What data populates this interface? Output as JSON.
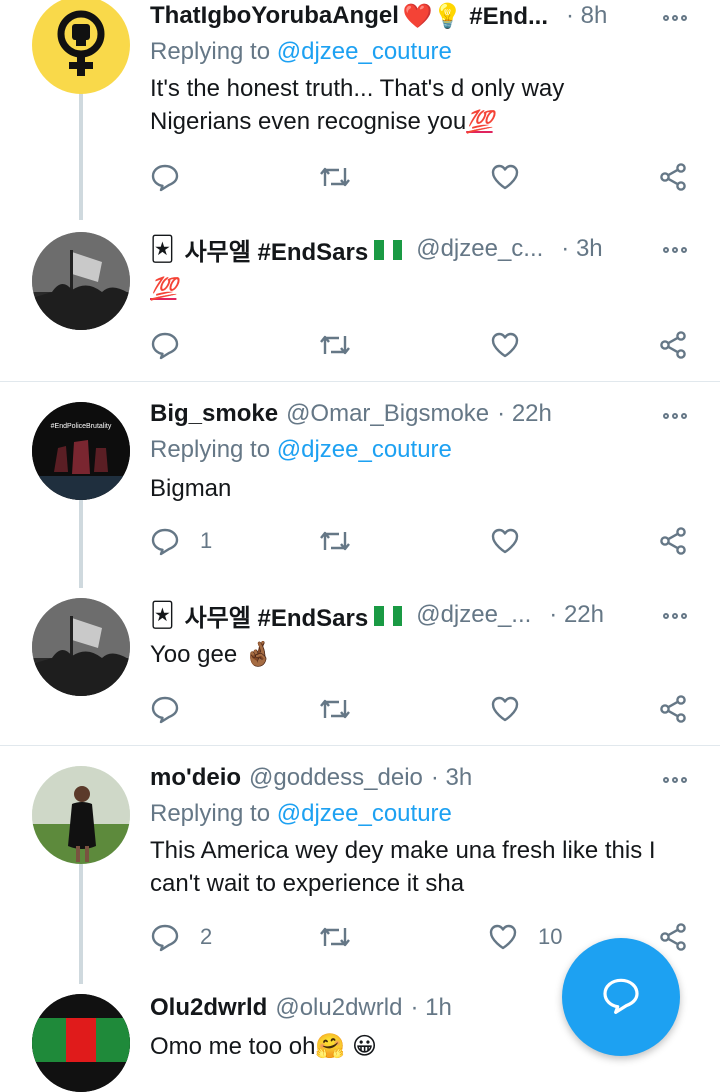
{
  "tweets": [
    {
      "name": "ThatIgboYorubaAngel",
      "name_suffix": "❤️💡 #End...",
      "handle": "",
      "time": "· 8h",
      "reply_prefix": "Replying to",
      "reply_to": "@djzee_couture",
      "text_lines": [
        "It's the honest truth... That's d only way",
        "Nigerians even recognise you"
      ],
      "text_emoji": "💯",
      "reply_count": "",
      "like_count": ""
    },
    {
      "name_prefix": "🃏",
      "name": "사무엘 #EndSars",
      "handle": "@djzee_c...",
      "time": "· 3h",
      "text": "💯",
      "reply_count": "",
      "like_count": ""
    },
    {
      "name": "Big_smoke",
      "handle": "@Omar_Bigsmoke",
      "time": "· 22h",
      "reply_prefix": "Replying to",
      "reply_to": "@djzee_couture",
      "text": "Bigman",
      "reply_count": "1",
      "like_count": ""
    },
    {
      "name_prefix": "🃏",
      "name": "사무엘 #EndSars",
      "handle": "@djzee_...",
      "time": "· 22h",
      "text": "Yoo gee 🤞🏾",
      "reply_count": "",
      "like_count": ""
    },
    {
      "name": "mo'deio",
      "handle": "@goddess_deio",
      "time": "· 3h",
      "reply_prefix": "Replying to",
      "reply_to": "@djzee_couture",
      "text_lines": [
        "This America wey dey make una fresh like this I",
        "can't wait to experience it sha"
      ],
      "reply_count": "2",
      "like_count": "10"
    },
    {
      "name": "Olu2dwrld",
      "handle": "@olu2dwrld",
      "time": "· 1h",
      "text": "Omo me too oh🤗 😀",
      "reply_count": "",
      "like_count": ""
    }
  ],
  "avatar_labels": {
    "big_smoke": "#EndPoliceBrutality"
  },
  "colors": {
    "accent": "#1da1f2",
    "muted": "#657786",
    "divider": "#e1e8ed",
    "heart": "#e0245e"
  },
  "icons": [
    "reply-icon",
    "retweet-icon",
    "like-icon",
    "share-icon",
    "more-icon",
    "compose-reply-icon"
  ]
}
